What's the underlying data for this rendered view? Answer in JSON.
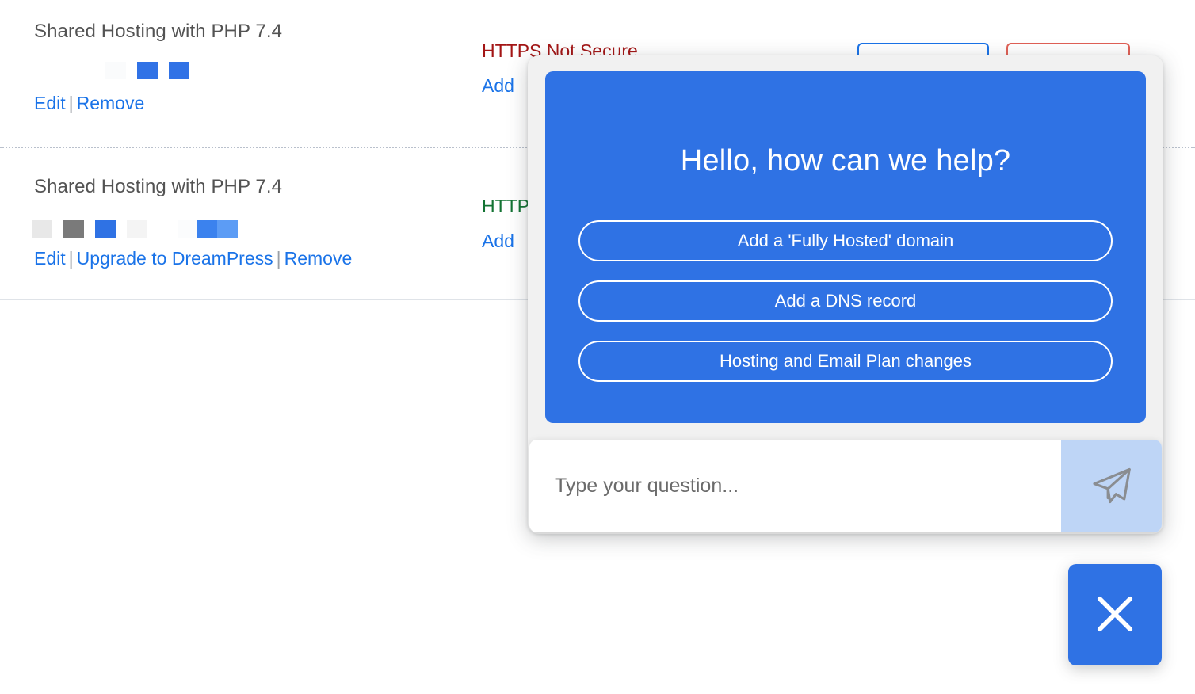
{
  "background": {
    "plans": [
      {
        "title": "Shared Hosting with PHP 7.4",
        "https_status": "HTTPS Not Secure",
        "https_state": "insecure",
        "add_link": "Add ",
        "links": [
          {
            "label": "Edit"
          },
          {
            "label": "Remove"
          }
        ],
        "swatches": [
          "#fafbfc",
          "#3072e6",
          "#3072e6"
        ]
      },
      {
        "title": "Shared Hosting with PHP 7.4",
        "https_status": "HTTP",
        "https_state": "secure",
        "add_link": "Add ",
        "links": [
          {
            "label": "Edit"
          },
          {
            "label": "Upgrade to DreamPress"
          },
          {
            "label": "Remove"
          }
        ],
        "swatches": [
          "#e8e8e8",
          "#7a7a7a",
          "#2f72e4",
          "#f4f4f4",
          "#3b82ee",
          "#5c9cf5"
        ]
      }
    ],
    "separator": "|",
    "action_buttons": [
      {
        "name": "primary-outline-button",
        "accent": "#1a73e8"
      },
      {
        "name": "danger-outline-button",
        "accent": "#e06055"
      }
    ]
  },
  "chat": {
    "greeting": "Hello, how can we help?",
    "quick_replies": [
      "Add a 'Fully Hosted' domain",
      "Add a DNS record",
      "Hosting and Email Plan changes"
    ],
    "input": {
      "value": "",
      "placeholder": "Type your question..."
    },
    "send_icon": "send-paper-plane-icon",
    "close_icon": "close-x-icon",
    "colors": {
      "panel_blue": "#2f72e4",
      "send_button_blue": "#bed5f6",
      "widget_shell": "#f1f1f1",
      "text_white": "#ffffff"
    }
  }
}
